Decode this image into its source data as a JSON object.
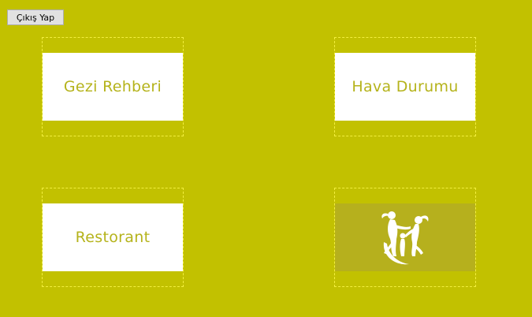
{
  "toolbar": {
    "logout_label": "Çıkış Yap"
  },
  "tiles": [
    {
      "label": "Gezi Rehberi"
    },
    {
      "label": "Hava Durumu"
    },
    {
      "label": "Restorant"
    },
    {
      "icon": "dancing-figures-logo-icon"
    }
  ],
  "colors": {
    "background": "#c2c100",
    "tile_text": "#b5b31b",
    "tile_border": "#f3ef3e",
    "logo_background": "#b6b01d"
  }
}
